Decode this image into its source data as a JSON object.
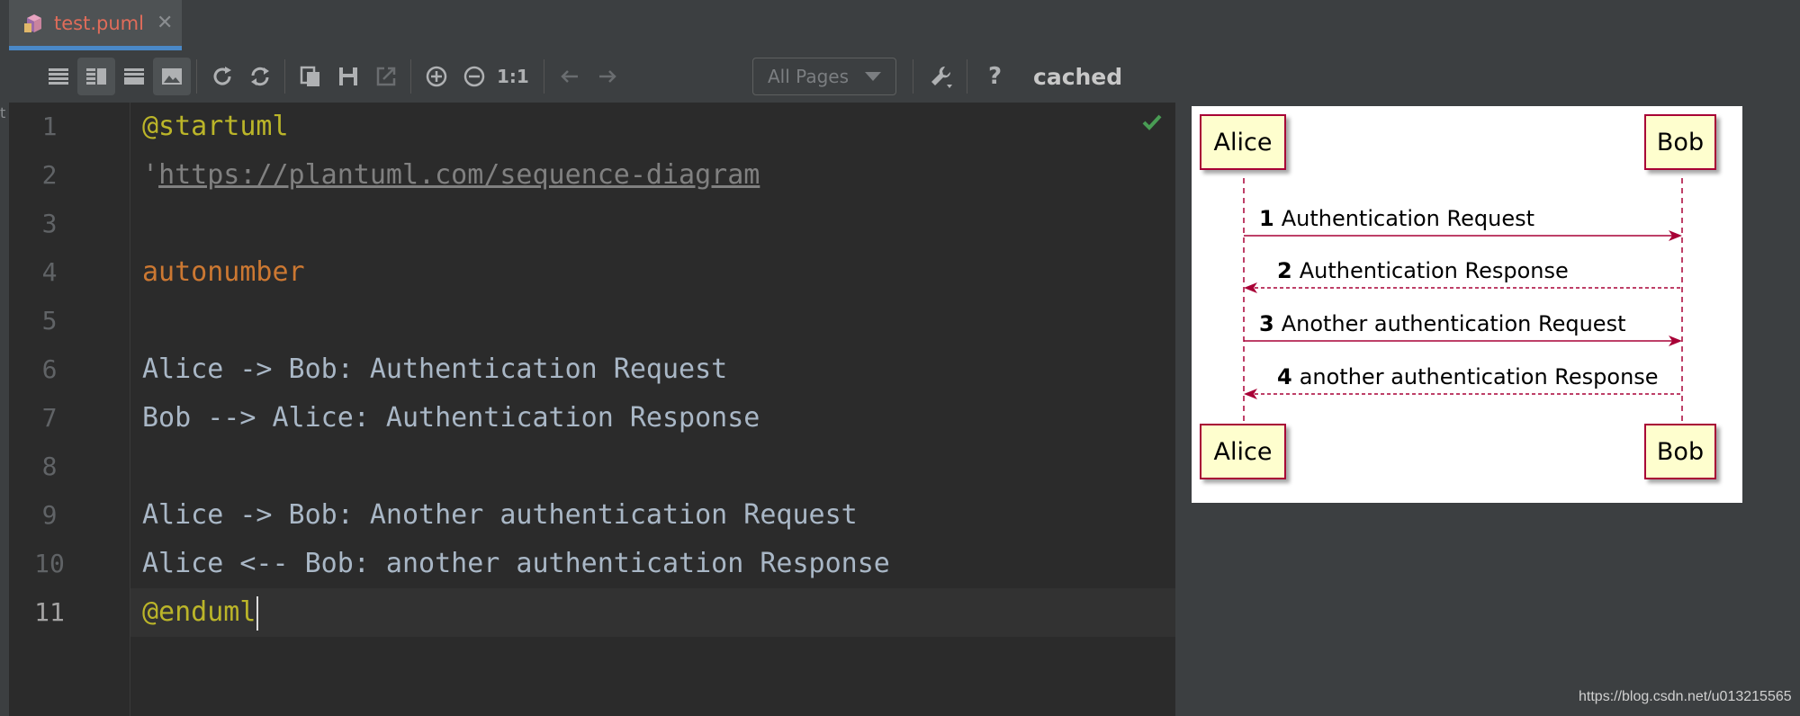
{
  "tab": {
    "label": "test.puml",
    "close": "✕"
  },
  "strip": {
    "letter": "t"
  },
  "toolbar": {
    "pages_select": "All Pages",
    "zoom_reset": "1:1",
    "help": "?",
    "status": "cached"
  },
  "editor": {
    "line_numbers": [
      "1",
      "2",
      "3",
      "4",
      "5",
      "6",
      "7",
      "8",
      "9",
      "10",
      "11"
    ],
    "lines": {
      "l1": "@startuml",
      "l2_prefix": "'",
      "l2_link": "https://plantuml.com/sequence-diagram",
      "l4": "autonumber",
      "l6": "Alice -> Bob: Authentication Request",
      "l7": "Bob --> Alice: Authentication Response",
      "l9": "Alice -> Bob: Another authentication Request",
      "l10": "Alice <-- Bob: another authentication Response",
      "l11": "@enduml"
    }
  },
  "diagram": {
    "participants": [
      "Alice",
      "Bob"
    ],
    "messages": [
      {
        "num": "1",
        "text": "Authentication Request",
        "from": "Alice",
        "to": "Bob",
        "style": "solid"
      },
      {
        "num": "2",
        "text": "Authentication Response",
        "from": "Bob",
        "to": "Alice",
        "style": "dashed"
      },
      {
        "num": "3",
        "text": "Another authentication Request",
        "from": "Alice",
        "to": "Bob",
        "style": "solid"
      },
      {
        "num": "4",
        "text": "another authentication Response",
        "from": "Bob",
        "to": "Alice",
        "style": "dashed"
      }
    ],
    "colors": {
      "participant_fill": "#fefece",
      "participant_border": "#a80036",
      "arrow": "#a80036"
    }
  },
  "watermark": "https://blog.csdn.net/u013215565"
}
